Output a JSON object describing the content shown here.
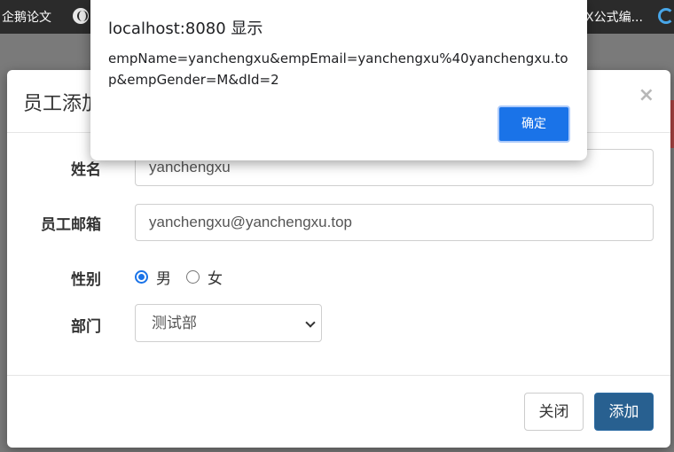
{
  "bookmarks": [
    {
      "label": "企鹅论文",
      "icon": "none"
    },
    {
      "label": "",
      "icon": "globe-icon"
    },
    {
      "label": "X公式编...",
      "icon": "none"
    },
    {
      "label": "",
      "icon": "swirl-logo-icon"
    }
  ],
  "modal": {
    "title": "员工添加",
    "close_symbol": "×",
    "fields": {
      "name": {
        "label": "姓名",
        "value": "yanchengxu"
      },
      "email": {
        "label": "员工邮箱",
        "value": "yanchengxu@yanchengxu.top"
      },
      "gender": {
        "label": "性别",
        "options": [
          {
            "label": "男",
            "checked": true
          },
          {
            "label": "女",
            "checked": false
          }
        ]
      },
      "department": {
        "label": "部门",
        "selected": "测试部"
      }
    },
    "footer": {
      "close_label": "关闭",
      "submit_label": "添加"
    }
  },
  "alert": {
    "title": "localhost:8080 显示",
    "message": "empName=yanchengxu&empEmail=yanchengxu%40yanchengxu.top&empGender=M&dId=2",
    "ok_label": "确定"
  },
  "colors": {
    "primary": "#286090",
    "alert_button": "#1a73e8",
    "overlay": "#7a7a7a"
  }
}
